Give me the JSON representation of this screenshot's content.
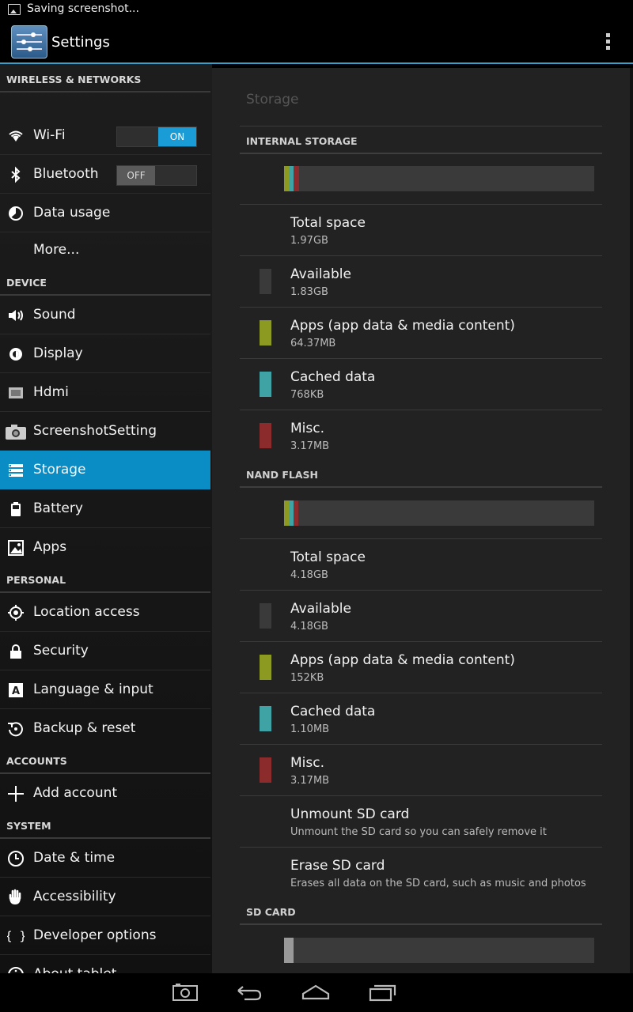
{
  "status_bar": {
    "notification": "Saving screenshot..."
  },
  "action_bar": {
    "title": "Settings"
  },
  "sidebar": {
    "headers": {
      "wireless": "WIRELESS & NETWORKS",
      "device": "DEVICE",
      "personal": "PERSONAL",
      "accounts": "ACCOUNTS",
      "system": "SYSTEM"
    },
    "items": {
      "wifi": "Wi-Fi",
      "bluetooth": "Bluetooth",
      "data_usage": "Data usage",
      "more": "More...",
      "sound": "Sound",
      "display": "Display",
      "hdmi": "Hdmi",
      "screenshot": "ScreenshotSetting",
      "storage": "Storage",
      "battery": "Battery",
      "apps": "Apps",
      "location": "Location access",
      "security": "Security",
      "language": "Language & input",
      "backup": "Backup & reset",
      "add_account": "Add account",
      "date_time": "Date & time",
      "accessibility": "Accessibility",
      "developer": "Developer options",
      "about": "About tablet"
    },
    "wifi_toggle": "ON",
    "bluetooth_toggle": "OFF",
    "selected": "Storage"
  },
  "storage": {
    "title": "Storage",
    "internal": {
      "header": "INTERNAL STORAGE",
      "rows": [
        {
          "title": "Total space",
          "value": "1.97GB"
        },
        {
          "title": "Available",
          "value": "1.83GB"
        },
        {
          "title": "Apps (app data & media content)",
          "value": "64.37MB"
        },
        {
          "title": "Cached data",
          "value": "768KB"
        },
        {
          "title": "Misc.",
          "value": "3.17MB"
        }
      ]
    },
    "nand": {
      "header": "NAND FLASH",
      "rows": [
        {
          "title": "Total space",
          "value": "4.18GB"
        },
        {
          "title": "Available",
          "value": "4.18GB"
        },
        {
          "title": "Apps (app data & media content)",
          "value": "152KB"
        },
        {
          "title": "Cached data",
          "value": "1.10MB"
        },
        {
          "title": "Misc.",
          "value": "3.17MB"
        }
      ],
      "unmount": {
        "title": "Unmount SD card",
        "summary": "Unmount the SD card so you can safely remove it"
      },
      "erase": {
        "title": "Erase SD card",
        "summary": "Erases all data on the SD card, such as music and photos"
      }
    },
    "sdcard": {
      "header": "SD CARD"
    }
  },
  "colors": {
    "accent": "#0a8dc5",
    "apps": "#8c9a22",
    "cached": "#3fa3a6",
    "misc": "#8b2b2b",
    "available": "#3a3a3a"
  },
  "icons": {
    "status": "image-icon",
    "app": "settings-sliders-icon",
    "overflow": "overflow-menu-icon",
    "nav": [
      "camera-icon",
      "back-icon",
      "home-icon",
      "recents-icon"
    ]
  }
}
